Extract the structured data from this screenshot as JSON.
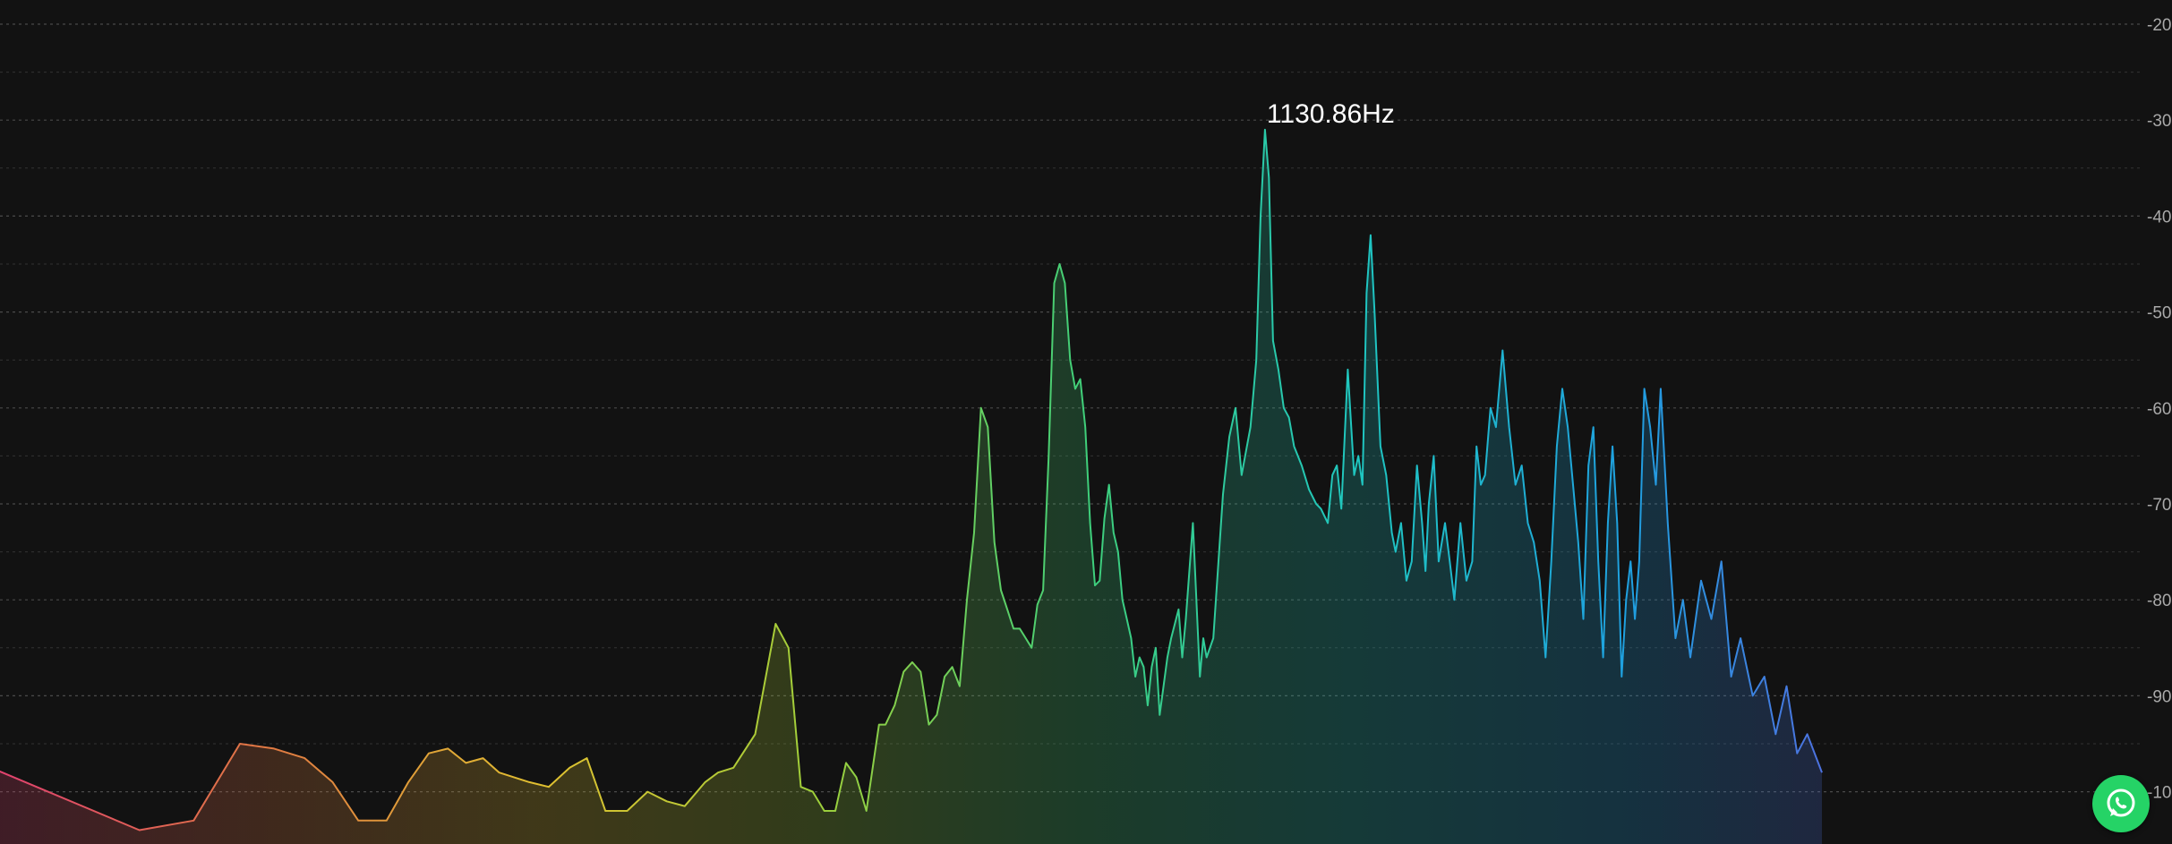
{
  "chart_data": {
    "type": "area",
    "title": "",
    "xlabel": "",
    "ylabel": "",
    "x_scale": "log",
    "xlim_hz": [
      20,
      20000
    ],
    "ylim": [
      -100,
      -20
    ],
    "y_ticks": [
      {
        "value": -20,
        "label": "-20"
      },
      {
        "value": -30,
        "label": "-30"
      },
      {
        "value": -40,
        "label": "-40"
      },
      {
        "value": -50,
        "label": "-50"
      },
      {
        "value": -60,
        "label": "-60"
      },
      {
        "value": -70,
        "label": "-70"
      },
      {
        "value": -80,
        "label": "-80"
      },
      {
        "value": -90,
        "label": "-90"
      },
      {
        "value": -100,
        "label": "-100"
      }
    ],
    "grid": true,
    "legend": "none",
    "peak_annotation": {
      "frequency_hz": 1130.86,
      "level_db": -31.0,
      "label": "1130.86Hz"
    },
    "color_stops": [
      "#e0426e",
      "#e07a42",
      "#e0c030",
      "#9fcf3a",
      "#3fcf7a",
      "#1fc6c0",
      "#1fa0e0",
      "#5f5fe0",
      "#8f4fd0"
    ],
    "series": [
      {
        "points": [
          [
            20,
            -97.5
          ],
          [
            32,
            -104
          ],
          [
            38,
            -103
          ],
          [
            44,
            -95
          ],
          [
            49,
            -95.5
          ],
          [
            54,
            -96.5
          ],
          [
            59,
            -99
          ],
          [
            64,
            -103
          ],
          [
            70,
            -103
          ],
          [
            75,
            -99
          ],
          [
            80,
            -96
          ],
          [
            85,
            -95.5
          ],
          [
            90,
            -97
          ],
          [
            95,
            -96.5
          ],
          [
            100,
            -98
          ],
          [
            110,
            -99
          ],
          [
            117,
            -99.5
          ],
          [
            125,
            -97.5
          ],
          [
            132,
            -96.5
          ],
          [
            140,
            -102
          ],
          [
            150,
            -102
          ],
          [
            160,
            -100
          ],
          [
            170,
            -101
          ],
          [
            180,
            -101.5
          ],
          [
            192,
            -99
          ],
          [
            200,
            -98
          ],
          [
            210,
            -97.5
          ],
          [
            225,
            -94
          ],
          [
            240,
            -82.5
          ],
          [
            250,
            -85
          ],
          [
            260,
            -99.5
          ],
          [
            270,
            -100
          ],
          [
            280,
            -102
          ],
          [
            290,
            -102
          ],
          [
            300,
            -97
          ],
          [
            310,
            -98.5
          ],
          [
            320,
            -102
          ],
          [
            333,
            -93
          ],
          [
            340,
            -93
          ],
          [
            350,
            -91
          ],
          [
            360,
            -87.5
          ],
          [
            370,
            -86.5
          ],
          [
            380,
            -87.5
          ],
          [
            390,
            -93
          ],
          [
            400,
            -92
          ],
          [
            410,
            -88
          ],
          [
            420,
            -87
          ],
          [
            430,
            -89
          ],
          [
            440,
            -80
          ],
          [
            450,
            -73
          ],
          [
            460,
            -60
          ],
          [
            470,
            -62
          ],
          [
            480,
            -74
          ],
          [
            490,
            -79
          ],
          [
            500,
            -81
          ],
          [
            510,
            -83
          ],
          [
            520,
            -83
          ],
          [
            530,
            -84
          ],
          [
            540,
            -85
          ],
          [
            550,
            -80.5
          ],
          [
            560,
            -79
          ],
          [
            570,
            -65
          ],
          [
            580,
            -47
          ],
          [
            590,
            -45
          ],
          [
            600,
            -47
          ],
          [
            610,
            -55
          ],
          [
            620,
            -58
          ],
          [
            630,
            -57
          ],
          [
            640,
            -62
          ],
          [
            650,
            -72
          ],
          [
            660,
            -78.5
          ],
          [
            670,
            -78
          ],
          [
            680,
            -71.5
          ],
          [
            690,
            -68
          ],
          [
            700,
            -73
          ],
          [
            710,
            -75
          ],
          [
            720,
            -80
          ],
          [
            730,
            -82
          ],
          [
            740,
            -84
          ],
          [
            750,
            -88
          ],
          [
            760,
            -86
          ],
          [
            770,
            -87
          ],
          [
            780,
            -91
          ],
          [
            790,
            -87
          ],
          [
            800,
            -85
          ],
          [
            810,
            -92
          ],
          [
            820,
            -89
          ],
          [
            830,
            -86
          ],
          [
            840,
            -84
          ],
          [
            860,
            -81
          ],
          [
            870,
            -86
          ],
          [
            880,
            -82
          ],
          [
            900,
            -72
          ],
          [
            920,
            -88
          ],
          [
            930,
            -84
          ],
          [
            940,
            -86
          ],
          [
            960,
            -84
          ],
          [
            990,
            -69
          ],
          [
            1010,
            -63
          ],
          [
            1030,
            -60
          ],
          [
            1050,
            -67
          ],
          [
            1080,
            -62
          ],
          [
            1100,
            -55
          ],
          [
            1115,
            -40
          ],
          [
            1130.86,
            -31
          ],
          [
            1145,
            -36
          ],
          [
            1160,
            -53
          ],
          [
            1180,
            -56
          ],
          [
            1200,
            -60
          ],
          [
            1220,
            -61
          ],
          [
            1240,
            -64
          ],
          [
            1270,
            -66
          ],
          [
            1300,
            -68.5
          ],
          [
            1330,
            -70
          ],
          [
            1350,
            -70.5
          ],
          [
            1380,
            -72
          ],
          [
            1400,
            -67
          ],
          [
            1420,
            -66
          ],
          [
            1440,
            -70.5
          ],
          [
            1470,
            -56
          ],
          [
            1500,
            -67
          ],
          [
            1520,
            -65
          ],
          [
            1540,
            -68
          ],
          [
            1560,
            -48
          ],
          [
            1580,
            -42
          ],
          [
            1600,
            -50
          ],
          [
            1630,
            -64
          ],
          [
            1660,
            -67
          ],
          [
            1690,
            -73
          ],
          [
            1710,
            -75
          ],
          [
            1740,
            -72
          ],
          [
            1770,
            -78
          ],
          [
            1800,
            -76
          ],
          [
            1830,
            -66
          ],
          [
            1860,
            -72
          ],
          [
            1880,
            -77
          ],
          [
            1900,
            -70
          ],
          [
            1930,
            -65
          ],
          [
            1960,
            -76
          ],
          [
            2000,
            -72
          ],
          [
            2030,
            -76
          ],
          [
            2060,
            -80
          ],
          [
            2100,
            -72
          ],
          [
            2140,
            -78
          ],
          [
            2180,
            -76
          ],
          [
            2210,
            -64
          ],
          [
            2240,
            -68
          ],
          [
            2270,
            -67
          ],
          [
            2310,
            -60
          ],
          [
            2350,
            -62
          ],
          [
            2400,
            -54
          ],
          [
            2450,
            -62
          ],
          [
            2500,
            -68
          ],
          [
            2550,
            -66
          ],
          [
            2600,
            -72
          ],
          [
            2650,
            -74
          ],
          [
            2700,
            -78
          ],
          [
            2750,
            -86
          ],
          [
            2800,
            -76
          ],
          [
            2850,
            -64
          ],
          [
            2900,
            -58
          ],
          [
            2950,
            -62
          ],
          [
            3000,
            -68
          ],
          [
            3050,
            -74
          ],
          [
            3100,
            -82
          ],
          [
            3150,
            -66
          ],
          [
            3200,
            -62
          ],
          [
            3250,
            -76
          ],
          [
            3300,
            -86
          ],
          [
            3350,
            -72
          ],
          [
            3400,
            -64
          ],
          [
            3450,
            -72
          ],
          [
            3500,
            -88
          ],
          [
            3550,
            -80
          ],
          [
            3600,
            -76
          ],
          [
            3650,
            -82
          ],
          [
            3700,
            -76
          ],
          [
            3760,
            -58
          ],
          [
            3830,
            -62
          ],
          [
            3900,
            -68
          ],
          [
            3960,
            -58
          ],
          [
            4050,
            -72
          ],
          [
            4150,
            -84
          ],
          [
            4250,
            -80
          ],
          [
            4350,
            -86
          ],
          [
            4500,
            -78
          ],
          [
            4650,
            -82
          ],
          [
            4800,
            -76
          ],
          [
            4950,
            -88
          ],
          [
            5100,
            -84
          ],
          [
            5300,
            -90
          ],
          [
            5500,
            -88
          ],
          [
            5700,
            -94
          ],
          [
            5900,
            -89
          ],
          [
            6100,
            -96
          ],
          [
            6300,
            -94
          ],
          [
            6600,
            -98
          ]
        ]
      }
    ]
  },
  "ui": {
    "whatsapp_icon": "whatsapp-icon",
    "accent": "#25D366"
  }
}
